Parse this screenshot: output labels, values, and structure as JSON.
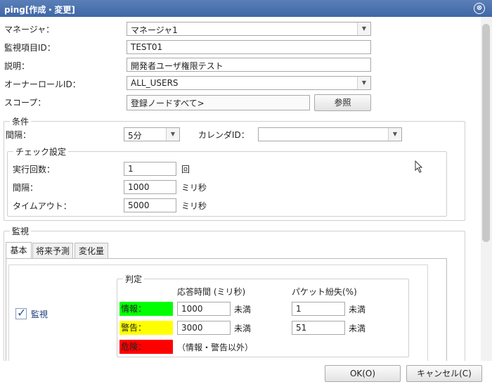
{
  "dialog": {
    "title": "ping[作成・変更]",
    "close_glyph": "⊗"
  },
  "form": {
    "manager_label": "マネージャ：",
    "manager_value": "マネージャ1",
    "monitor_id_label": "監視項目ID：",
    "monitor_id_value": "TEST01",
    "description_label": "説明：",
    "description_value": "開発者ユーザ権限テスト",
    "owner_role_label": "オーナーロールID：",
    "owner_role_value": "ALL_USERS",
    "scope_label": "スコープ：",
    "scope_value": "登録ノードすべて>",
    "scope_ref_button": "参照"
  },
  "condition": {
    "legend": "条件",
    "interval_label": "間隔：",
    "interval_value": "5分",
    "calendar_label": "カレンダID：",
    "calendar_value": ""
  },
  "check": {
    "legend": "チェック設定",
    "runs_label": "実行回数：",
    "runs_value": "1",
    "runs_unit": "回",
    "interval_label": "間隔：",
    "interval_value": "1000",
    "interval_unit": "ミリ秒",
    "timeout_label": "タイムアウト：",
    "timeout_value": "5000",
    "timeout_unit": "ミリ秒"
  },
  "monitor": {
    "legend": "監視",
    "tabs": [
      "基本",
      "将来予測",
      "変化量"
    ],
    "enable_label": "監視",
    "enabled": true
  },
  "judgement": {
    "legend": "判定",
    "col_response": "応答時間 (ミリ秒)",
    "col_packet": "パケット紛失(%)",
    "info_label": "情報：",
    "info_response": "1000",
    "info_packet": "1",
    "warn_label": "警告：",
    "warn_response": "3000",
    "warn_packet": "51",
    "less_than": "未満",
    "crit_label": "危険：",
    "crit_note": "（情報・警告以外）",
    "colors": {
      "info": "#00ff00",
      "warn": "#ffff00",
      "crit": "#ff0000"
    }
  },
  "footer": {
    "ok_button": "OK(O)",
    "cancel_button": "キャンセル(C)"
  },
  "icons": {
    "dropdown": "▼",
    "check": "✓"
  }
}
